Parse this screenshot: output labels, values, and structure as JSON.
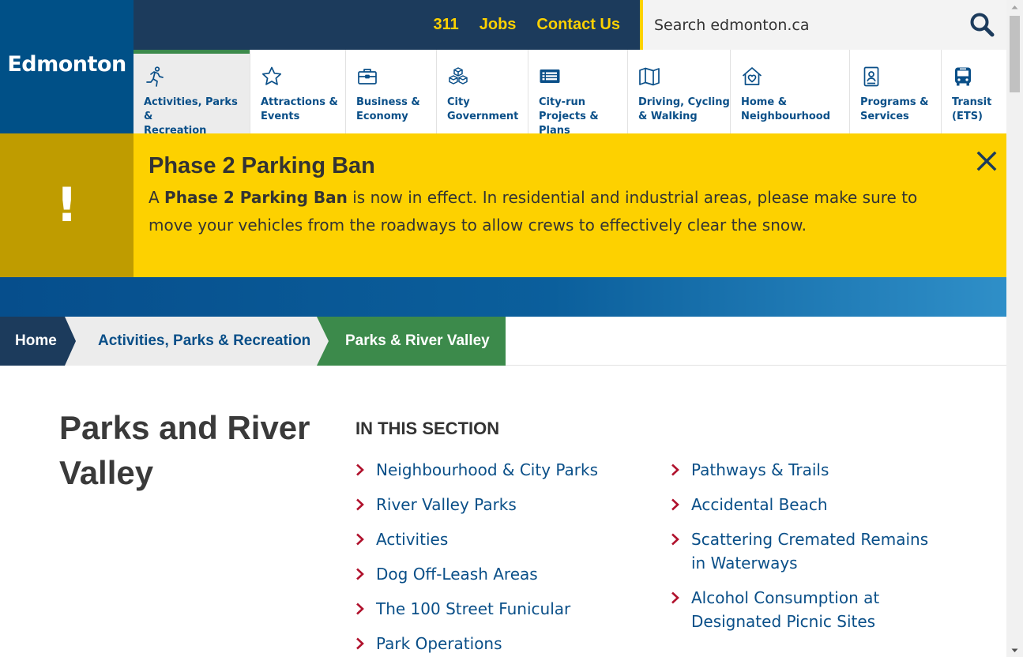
{
  "header": {
    "logo_text": "Edmonton",
    "utility_links": [
      "311",
      "Jobs",
      "Contact Us"
    ],
    "search": {
      "placeholder": "Search edmonton.ca",
      "icon": "search-icon"
    }
  },
  "nav": {
    "items": [
      {
        "label": "Activities, Parks &\nRecreation",
        "icon": "running-person-icon",
        "active": true
      },
      {
        "label": "Attractions &\nEvents",
        "icon": "star-icon",
        "active": false
      },
      {
        "label": "Business &\nEconomy",
        "icon": "briefcase-icon",
        "active": false
      },
      {
        "label": "City\nGovernment",
        "icon": "cubes-icon",
        "active": false
      },
      {
        "label": "City-run\nProjects & Plans",
        "icon": "list-board-icon",
        "active": false
      },
      {
        "label": "Driving, Cycling\n& Walking",
        "icon": "map-icon",
        "active": false
      },
      {
        "label": "Home &\nNeighbourhood",
        "icon": "house-heart-icon",
        "active": false
      },
      {
        "label": "Programs &\nServices",
        "icon": "id-badge-icon",
        "active": false
      },
      {
        "label": "Transit\n(ETS)",
        "icon": "bus-icon",
        "active": false
      }
    ]
  },
  "alert": {
    "title": "Phase 2 Parking Ban",
    "body_prefix": "A ",
    "body_bold": "Phase 2 Parking Ban",
    "body_suffix": " is now in effect. In residential and industrial areas, please make sure to move your vehicles from the roadways to allow crews to effectively clear the snow.",
    "icon_text": "!",
    "background": "#fdd100",
    "side_color": "#bf9c00"
  },
  "breadcrumb": {
    "home": "Home",
    "parent": "Activities, Parks & Recreation",
    "current": "Parks & River Valley"
  },
  "main": {
    "title": "Parks and River Valley",
    "section_heading": "IN THIS SECTION",
    "links_col1": [
      "Neighbourhood & City Parks",
      "River Valley Parks",
      "Activities",
      "Dog Off-Leash Areas",
      "The 100 Street Funicular",
      "Park Operations"
    ],
    "links_col2": [
      "Pathways & Trails",
      "Accidental Beach",
      "Scattering Cremated Remains in Waterways",
      "Alcohol Consumption at Designated Picnic Sites"
    ]
  },
  "colors": {
    "brand_blue": "#005087",
    "navy": "#1c3b5c",
    "accent_yellow": "#fdd100",
    "green": "#3c8a4b",
    "link_blue": "#0a4f88",
    "chevron_red": "#b0122d"
  }
}
